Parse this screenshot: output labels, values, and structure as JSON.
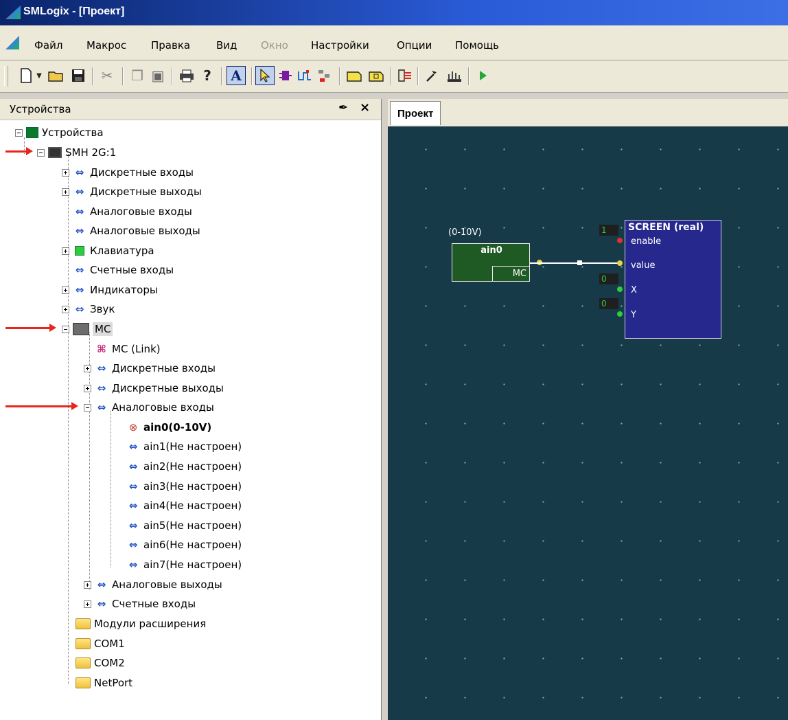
{
  "window": {
    "title": "SMLogix - [Проект]"
  },
  "menu": [
    {
      "label": "Файл",
      "enabled": true
    },
    {
      "label": "Макрос",
      "enabled": true
    },
    {
      "label": "Правка",
      "enabled": true
    },
    {
      "label": "Вид",
      "enabled": true
    },
    {
      "label": "Окно",
      "enabled": false
    },
    {
      "label": "Настройки",
      "enabled": true
    },
    {
      "label": "Опции",
      "enabled": true
    },
    {
      "label": "Помощь",
      "enabled": true
    }
  ],
  "toolbar": {
    "icons": [
      "new-file-icon",
      "dropdown-arrow-icon",
      "open-folder-icon",
      "save-icon",
      "cut-icon",
      "copy-icon",
      "paste-icon",
      "print-icon",
      "help-icon",
      "text-tool-icon",
      "select-pointer-icon",
      "block-tool-icon",
      "wire-tool-icon",
      "network-tool-icon",
      "input-tool-icon",
      "output-tool-icon",
      "compile-icon",
      "build-icon",
      "upload-icon",
      "run-icon"
    ],
    "text_tool_glyph": "A",
    "help_glyph": "?"
  },
  "devices_panel": {
    "title": "Устройства",
    "tree": {
      "root": "Устройства",
      "smh": "SMH 2G:1",
      "smh_children": [
        "Дискретные входы",
        "Дискретные выходы",
        "Аналоговые входы",
        "Аналоговые выходы",
        "Клавиатура",
        "Счетные входы",
        "Индикаторы",
        "Звук"
      ],
      "mc": "MC",
      "mc_children": {
        "link": "MC (Link)",
        "di": "Дискретные входы",
        "do": "Дискретные выходы",
        "ai": "Аналоговые входы",
        "ai_children": [
          "ain0(0-10V)",
          "ain1(Не настроен)",
          "ain2(Не настроен)",
          "ain3(Не настроен)",
          "ain4(Не настроен)",
          "ain5(Не настроен)",
          "ain6(Не настроен)",
          "ain7(Не настроен)"
        ],
        "ao": "Аналоговые выходы",
        "ci": "Счетные входы"
      },
      "folders": [
        "Модули расширения",
        "COM1",
        "COM2",
        "NetPort"
      ]
    }
  },
  "project": {
    "tab": "Проект",
    "ain_block": {
      "label": "(0-10V)",
      "name": "ain0",
      "module": "MC"
    },
    "screen_block": {
      "title": "SCREEN (real)",
      "pins": [
        {
          "name": "enable",
          "value": "1",
          "dot_color": "#e03030"
        },
        {
          "name": "value",
          "value": "",
          "dot_color": "#e8d44a"
        },
        {
          "name": "X",
          "value": "0",
          "dot_color": "#2ecc40"
        },
        {
          "name": "Y",
          "value": "0",
          "dot_color": "#2ecc40"
        }
      ]
    }
  },
  "colors": {
    "canvas": "#163a48",
    "ain_block": "#1f5a24",
    "screen_block": "#26288e",
    "annotation_arrow": "#e8261b"
  }
}
